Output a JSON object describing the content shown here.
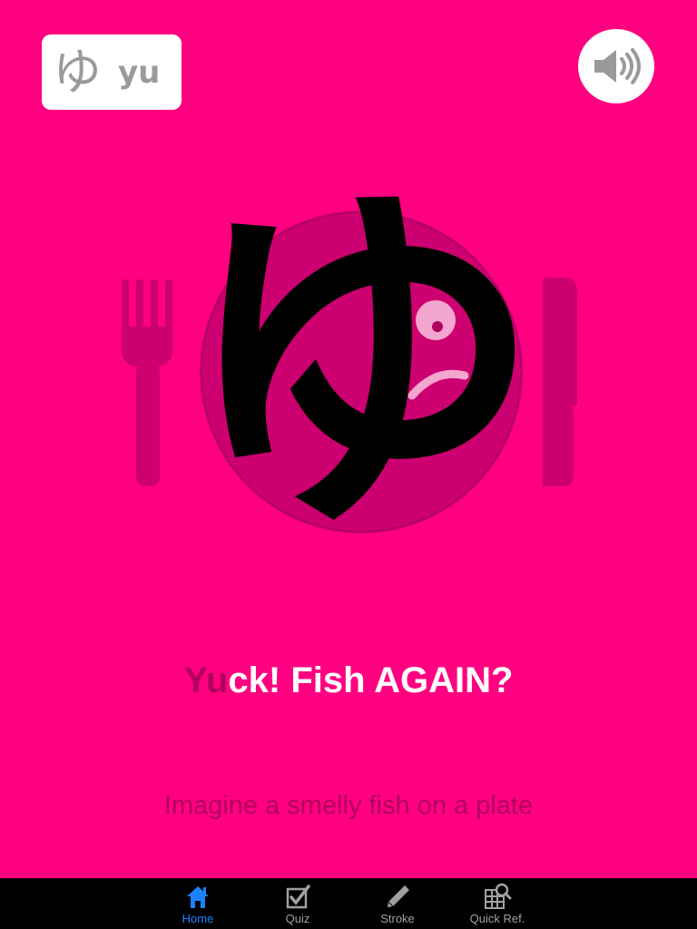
{
  "header": {
    "kana": "ゆ",
    "romaji": "yu"
  },
  "illustration": {
    "character": "ゆ"
  },
  "mnemonic": {
    "headline_highlight": "Yu",
    "headline_rest": "ck! Fish AGAIN?",
    "description": "Imagine a smelly fish on a plate"
  },
  "tabbar": {
    "tabs": [
      {
        "label": "Home",
        "icon": "home-icon",
        "active": true
      },
      {
        "label": "Quiz",
        "icon": "checkbox-icon",
        "active": false
      },
      {
        "label": "Stroke",
        "icon": "pencil-icon",
        "active": false
      },
      {
        "label": "Quick Ref.",
        "icon": "grid-search-icon",
        "active": false
      }
    ]
  },
  "colors": {
    "background": "#ff0080",
    "accent": "#b0005f",
    "active_tab": "#1a82ff"
  }
}
